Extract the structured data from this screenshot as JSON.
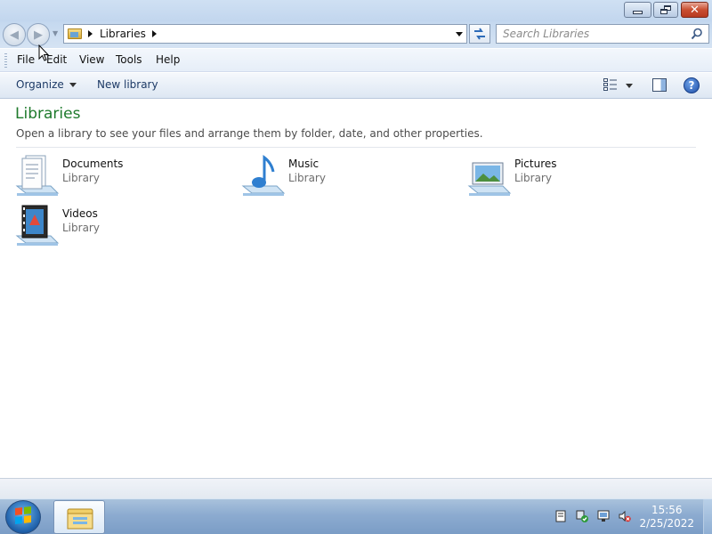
{
  "window": {
    "minimize_icon": "minimize-icon",
    "maximize_icon": "restore-icon",
    "close_icon": "close-icon"
  },
  "navigation": {
    "back_icon": "back-arrow-icon",
    "forward_icon": "forward-arrow-icon",
    "address_crumb": "Libraries",
    "search_placeholder": "Search Libraries",
    "refresh_icon": "refresh-icon"
  },
  "menu": {
    "items": [
      {
        "label": "File"
      },
      {
        "label": "Edit"
      },
      {
        "label": "View"
      },
      {
        "label": "Tools"
      },
      {
        "label": "Help"
      }
    ]
  },
  "commands": {
    "organize": "Organize",
    "new_library": "New library"
  },
  "content": {
    "title": "Libraries",
    "subtitle": "Open a library to see your files and arrange them by folder, date, and other properties.",
    "libraries": [
      {
        "name": "Documents",
        "type": "Library",
        "icon": "documents-library-icon"
      },
      {
        "name": "Music",
        "type": "Library",
        "icon": "music-library-icon"
      },
      {
        "name": "Pictures",
        "type": "Library",
        "icon": "pictures-library-icon"
      },
      {
        "name": "Videos",
        "type": "Library",
        "icon": "videos-library-icon"
      }
    ]
  },
  "taskbar": {
    "time": "15:56",
    "date": "2/25/2022"
  },
  "colors": {
    "title_green": "#1e7a2c",
    "command_text": "#1d3a66"
  }
}
